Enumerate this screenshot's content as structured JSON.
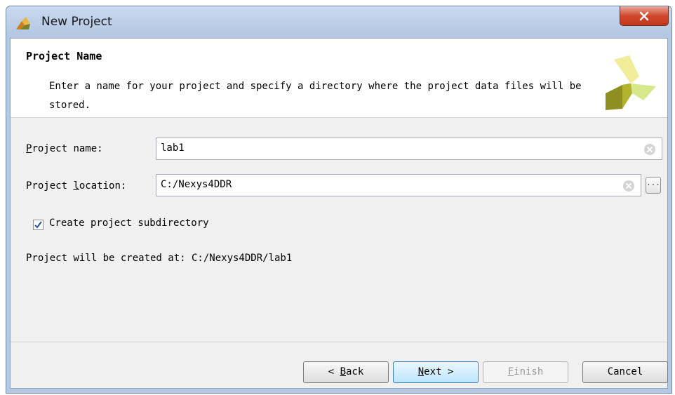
{
  "window": {
    "title": "New Project",
    "colors": {
      "titlebar": "#b4c8e3",
      "close": "#c0391e",
      "accent": "#3c7fb1"
    }
  },
  "header": {
    "title": "Project Name",
    "description": "Enter a name for your project and specify a directory where the project data files will be stored.",
    "logo_icon": "xilinx-logo-icon"
  },
  "form": {
    "name_label_key": "P",
    "name_label_rest": "roject name:",
    "name_value": "lab1",
    "location_label_start": "Project ",
    "location_label_key": "l",
    "location_label_rest": "ocation:",
    "location_value": "C:/Nexys4DDR",
    "browse_label": "...",
    "subdir_label": "Create project subdirectory",
    "subdir_checked": true,
    "created_at": "Project will be created at: C:/Nexys4DDR/lab1"
  },
  "buttons": {
    "back_prefix": "< ",
    "back_key": "B",
    "back_rest": "ack",
    "next_key": "N",
    "next_rest": "ext >",
    "finish_key": "F",
    "finish_rest": "inish",
    "cancel": "Cancel"
  }
}
